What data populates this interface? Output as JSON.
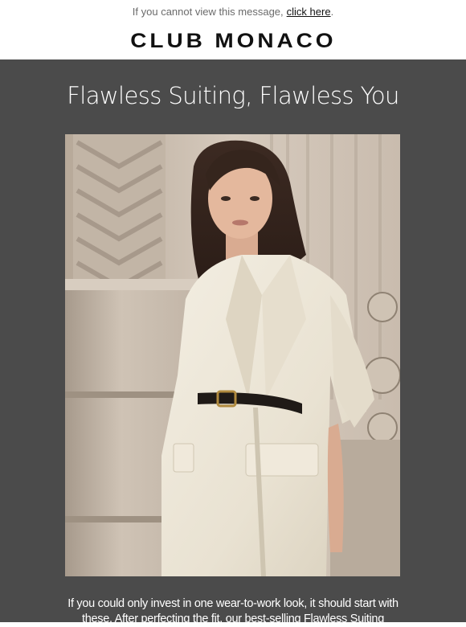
{
  "preheader": {
    "text": "If you cannot view this message,",
    "link_label": "click here",
    "trailing": "."
  },
  "brand": {
    "name": "CLUB MONACO"
  },
  "hero": {
    "headline": "Flawless Suiting, Flawless You",
    "body": "If you could only invest in one wear-to-work look, it should start with these. After perfecting the fit, our best-selling Flawless Suiting"
  },
  "colors": {
    "hero_background": "#4b4b4b",
    "text_light": "#ffffff",
    "brand": "#111111"
  }
}
